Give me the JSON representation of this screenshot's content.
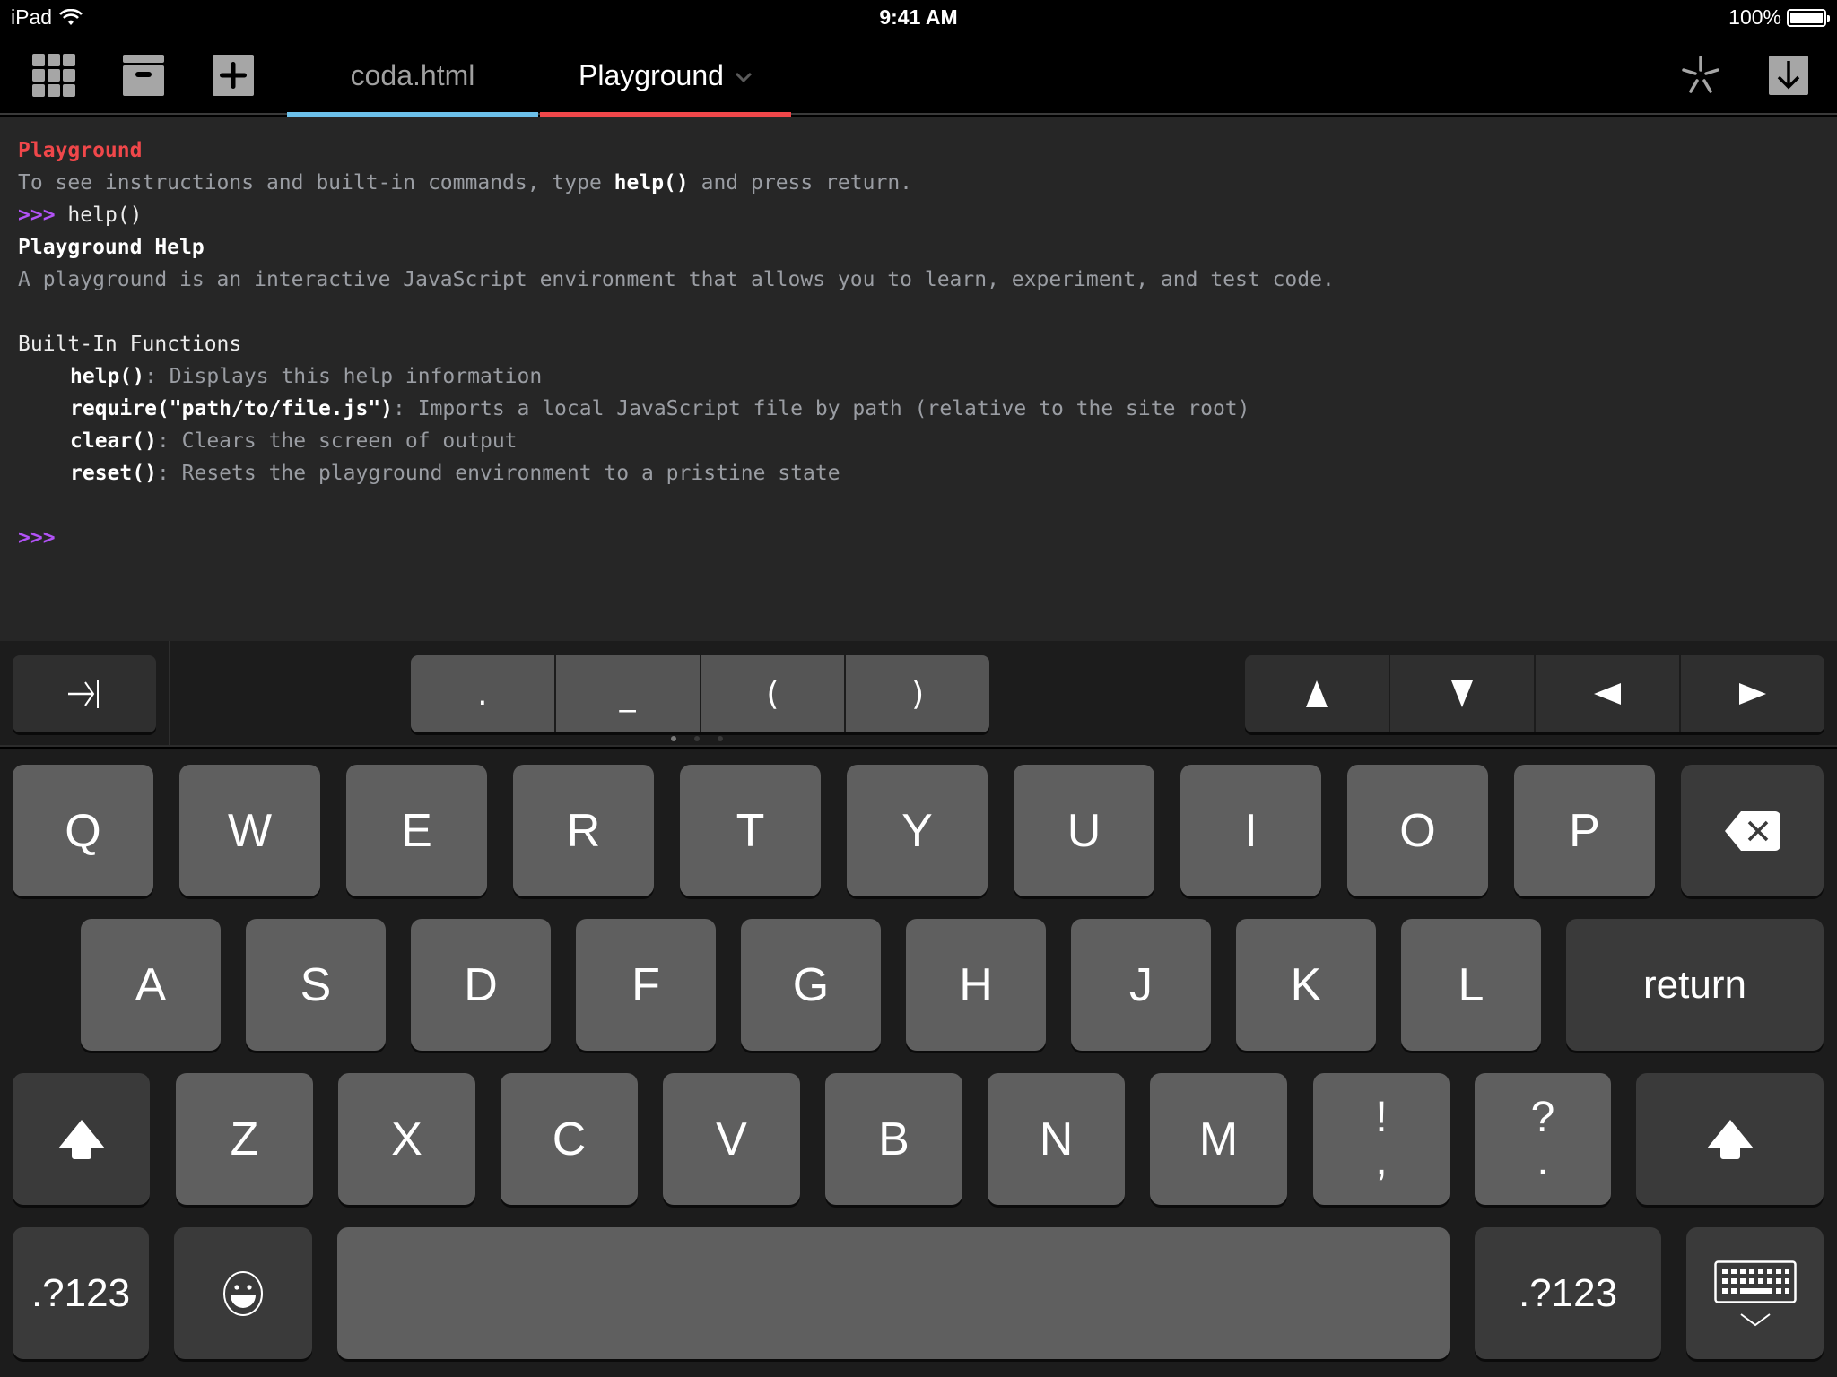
{
  "status_bar": {
    "device": "iPad",
    "time": "9:41 AM",
    "battery": "100%",
    "battery_level": 1.0
  },
  "toolbar": {
    "left_icons": [
      "grid-icon",
      "archive-box-icon",
      "add-icon"
    ],
    "tabs": [
      {
        "label": "coda.html",
        "active": false,
        "color": "#6cc0ea"
      },
      {
        "label": "Playground",
        "active": true,
        "color": "#f0474a",
        "has_dropdown": true
      }
    ],
    "right_icons": [
      "clips-asterisk-icon",
      "download-icon"
    ]
  },
  "console": {
    "title": "Playground",
    "intro_before": "To see instructions and built-in commands, type ",
    "intro_cmd": "help()",
    "intro_after": " and press return.",
    "prompt": ">>>",
    "entered_command": "help()",
    "help_title": "Playground Help",
    "help_description": "A playground is an interactive JavaScript environment that allows you to learn, experiment, and test code.",
    "functions_heading": "Built-In Functions",
    "functions": [
      {
        "name": "help()",
        "desc": "Displays this help information"
      },
      {
        "name": "require(\"path/to/file.js\")",
        "desc": "Imports a local JavaScript file by path (relative to the site root)"
      },
      {
        "name": "clear()",
        "desc": "Clears the screen of output"
      },
      {
        "name": "reset()",
        "desc": "Resets the playground environment to a pristine state"
      }
    ],
    "separator": ": ",
    "current_prompt": ">>>"
  },
  "accessory_bar": {
    "tab_key": "⇥",
    "symbols": [
      ".",
      "_",
      "(",
      ")"
    ],
    "arrows": [
      "▲",
      "▼",
      "◀",
      "▶"
    ],
    "page_count": 3,
    "current_page": 1
  },
  "keyboard": {
    "row1": [
      "Q",
      "W",
      "E",
      "R",
      "T",
      "Y",
      "U",
      "I",
      "O",
      "P"
    ],
    "row2": [
      "A",
      "S",
      "D",
      "F",
      "G",
      "H",
      "J",
      "K",
      "L"
    ],
    "row3": [
      "Z",
      "X",
      "C",
      "V",
      "B",
      "N",
      "M"
    ],
    "punct1": {
      "top": "!",
      "bottom": ","
    },
    "punct2": {
      "top": "?",
      "bottom": "."
    },
    "return_label": "return",
    "numbers_label": ".?123",
    "emoji": "☺"
  }
}
